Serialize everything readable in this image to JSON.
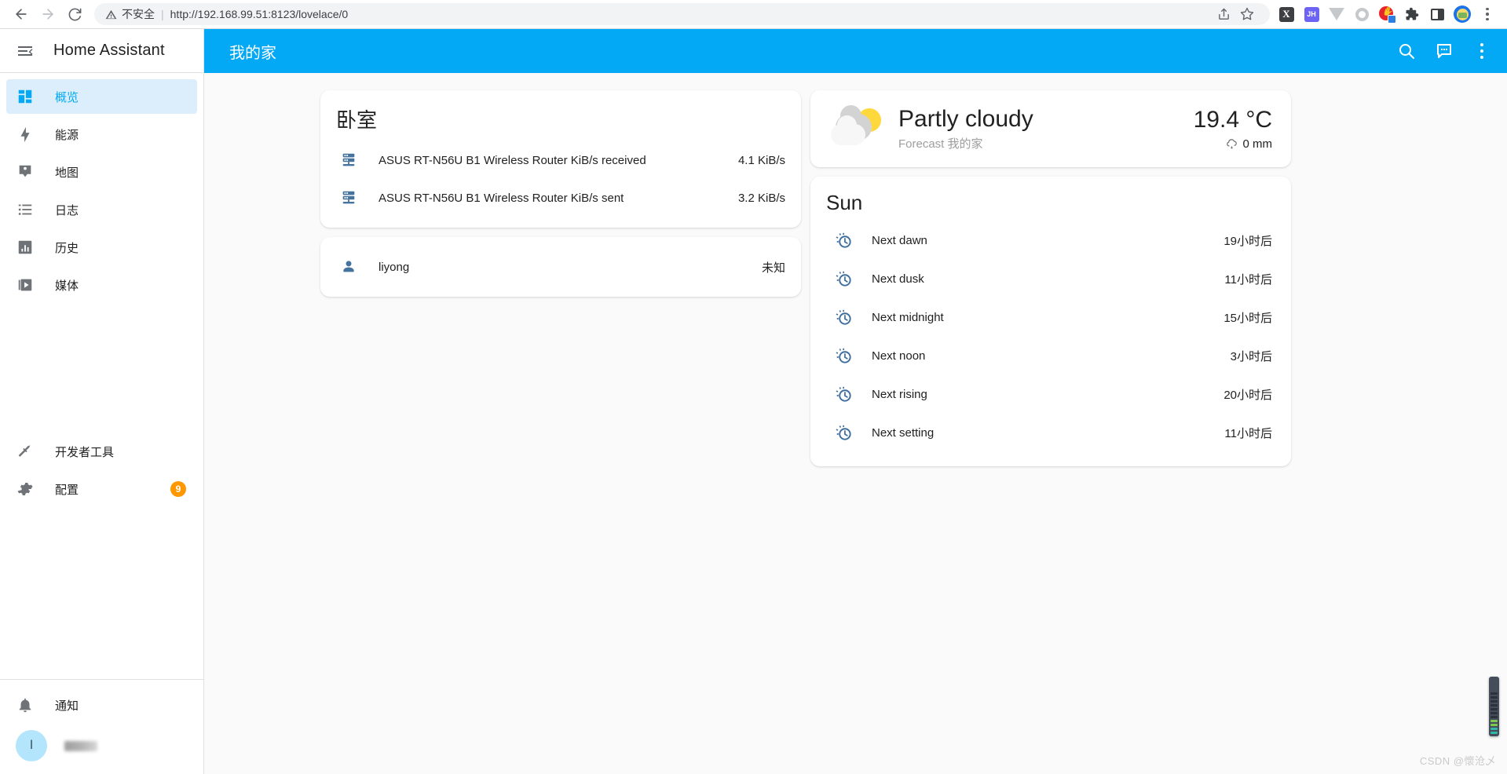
{
  "browser": {
    "back_icon": "back-arrow-icon",
    "forward_icon": "forward-arrow-icon",
    "reload_icon": "reload-icon",
    "security_label": "不安全",
    "security_icon": "warning-triangle-icon",
    "url_scheme": "http://",
    "url_host": "192.168.99.51:8123",
    "url_path": "/lovelace/0",
    "url_full": "http://192.168.99.51:8123/lovelace/0",
    "share_icon": "share-icon",
    "bookmark_icon": "star-icon",
    "extensions": [
      {
        "name": "ext-x-icon",
        "label": "X"
      },
      {
        "name": "ext-jh-icon",
        "label": "JH"
      },
      {
        "name": "ext-v-icon",
        "label": ""
      },
      {
        "name": "ext-circle-icon",
        "label": ""
      },
      {
        "name": "ext-stop-hand-icon",
        "label": ""
      },
      {
        "name": "ext-puzzle-icon",
        "label": ""
      },
      {
        "name": "ext-side-panel-icon",
        "label": ""
      },
      {
        "name": "ext-profile-avatar",
        "label": ""
      }
    ],
    "menu_icon": "chrome-kebab-menu-icon"
  },
  "sidebar": {
    "toggle_icon": "menu-collapse-icon",
    "title": "Home Assistant",
    "items": [
      {
        "label": "概览",
        "icon": "view-dashboard-icon",
        "active": true
      },
      {
        "label": "能源",
        "icon": "lightning-bolt-icon",
        "active": false
      },
      {
        "label": "地图",
        "icon": "map-marker-account-icon",
        "active": false
      },
      {
        "label": "日志",
        "icon": "format-list-bulleted-icon",
        "active": false
      },
      {
        "label": "历史",
        "icon": "chart-box-icon",
        "active": false
      },
      {
        "label": "媒体",
        "icon": "play-box-multiple-icon",
        "active": false
      }
    ],
    "bottom_items": [
      {
        "label": "开发者工具",
        "icon": "hammer-icon",
        "badge": ""
      },
      {
        "label": "配置",
        "icon": "cog-icon",
        "badge": "9"
      }
    ],
    "notifications": {
      "label": "通知",
      "icon": "bell-icon"
    },
    "user": {
      "initial": "l",
      "name": ""
    }
  },
  "topbar": {
    "title": "我的家",
    "search_icon": "search-icon",
    "assist_icon": "assist-chat-icon",
    "menu_icon": "kebab-menu-icon"
  },
  "cards": {
    "bedroom": {
      "title": "卧室",
      "rows": [
        {
          "icon": "router-network-icon",
          "name": "ASUS RT-N56U B1 Wireless Router KiB/s received",
          "state": "4.1 KiB/s"
        },
        {
          "icon": "router-network-icon",
          "name": "ASUS RT-N56U B1 Wireless Router KiB/s sent",
          "state": "3.2 KiB/s"
        }
      ]
    },
    "person": {
      "rows": [
        {
          "icon": "account-icon",
          "name": "liyong",
          "state": "未知"
        }
      ]
    },
    "weather": {
      "icon": "partly-cloudy-icon",
      "condition": "Partly cloudy",
      "subtitle": "Forecast 我的家",
      "temperature": "19.4 °C",
      "precipitation": "0 mm",
      "precip_icon": "weather-pouring-icon"
    },
    "sun": {
      "title": "Sun",
      "rows": [
        {
          "icon": "sun-clock-icon",
          "name": "Next dawn",
          "state": "19小时后"
        },
        {
          "icon": "sun-clock-icon",
          "name": "Next dusk",
          "state": "11小时后"
        },
        {
          "icon": "sun-clock-icon",
          "name": "Next midnight",
          "state": "15小时后"
        },
        {
          "icon": "sun-clock-icon",
          "name": "Next noon",
          "state": "3小时后"
        },
        {
          "icon": "sun-clock-icon",
          "name": "Next rising",
          "state": "20小时后"
        },
        {
          "icon": "sun-clock-icon",
          "name": "Next setting",
          "state": "11小时后"
        }
      ]
    }
  },
  "watermark": "CSDN @懷沧乄",
  "colors": {
    "accent": "#03a9f4",
    "sidebar_active_bg": "#dceefb",
    "badge": "#ff9800",
    "entity_icon": "#44739e",
    "card_bg": "#ffffff",
    "page_bg": "#fafafa"
  }
}
